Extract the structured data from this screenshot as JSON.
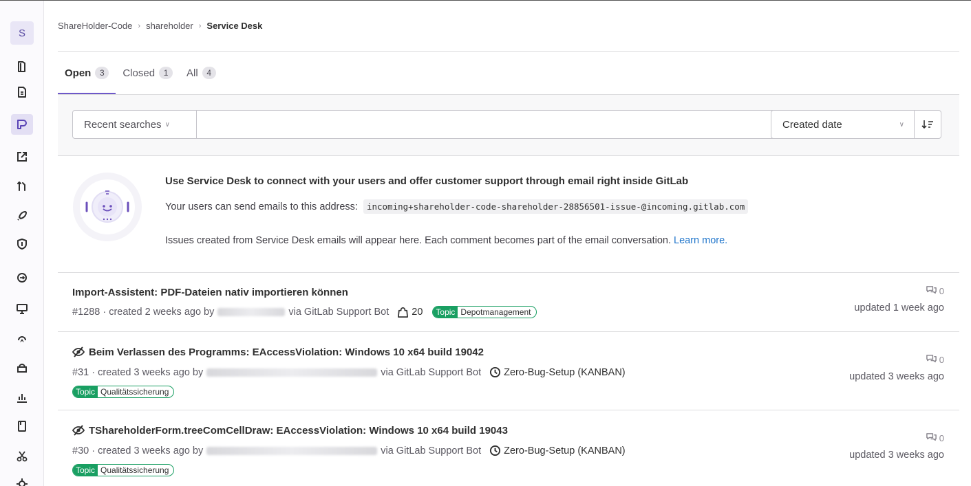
{
  "sidebar": {
    "project_initial": "S"
  },
  "breadcrumb": {
    "group": "ShareHolder-Code",
    "project": "shareholder",
    "current": "Service Desk",
    "separator": "›"
  },
  "tabs": [
    {
      "label": "Open",
      "count": "3"
    },
    {
      "label": "Closed",
      "count": "1"
    },
    {
      "label": "All",
      "count": "4"
    }
  ],
  "filter": {
    "recent_searches": "Recent searches",
    "search_value": "",
    "sort_label": "Created date"
  },
  "empty_state": {
    "title": "Use Service Desk to connect with your users and offer customer support through email right inside GitLab",
    "email_prefix": "Your users can send emails to this address:",
    "email": "incoming+shareholder-code-shareholder-28856501-issue-@incoming.gitlab.com",
    "info": "Issues created from Service Desk emails will appear here. Each comment becomes part of the email conversation.",
    "learn_more": "Learn more."
  },
  "issues": [
    {
      "title": "Import-Assistent: PDF-Dateien nativ importieren können",
      "confidential": false,
      "ref_created": "#1288 · created 2 weeks ago by",
      "via": "via GitLab Support Bot",
      "weight": "20",
      "label_scope": "Topic",
      "label_value": "Depotmanagement",
      "comments": "0",
      "updated": "updated 1 week ago"
    },
    {
      "title": "Beim Verlassen des Programms: EAccessViolation: Windows 10 x64 build 19042",
      "confidential": true,
      "ref_created": "#31 · created 3 weeks ago by",
      "via": "via GitLab Support Bot",
      "milestone": "Zero-Bug-Setup (KANBAN)",
      "label_scope": "Topic",
      "label_value": "Qualitätssicherung",
      "comments": "0",
      "updated": "updated 3 weeks ago"
    },
    {
      "title": "TShareholderForm.treeComCellDraw: EAccessViolation: Windows 10 x64 build 19043",
      "confidential": true,
      "ref_created": "#30 · created 3 weeks ago by",
      "via": "via GitLab Support Bot",
      "milestone": "Zero-Bug-Setup (KANBAN)",
      "label_scope": "Topic",
      "label_value": "Qualitätssicherung",
      "comments": "0",
      "updated": "updated 3 weeks ago"
    }
  ]
}
